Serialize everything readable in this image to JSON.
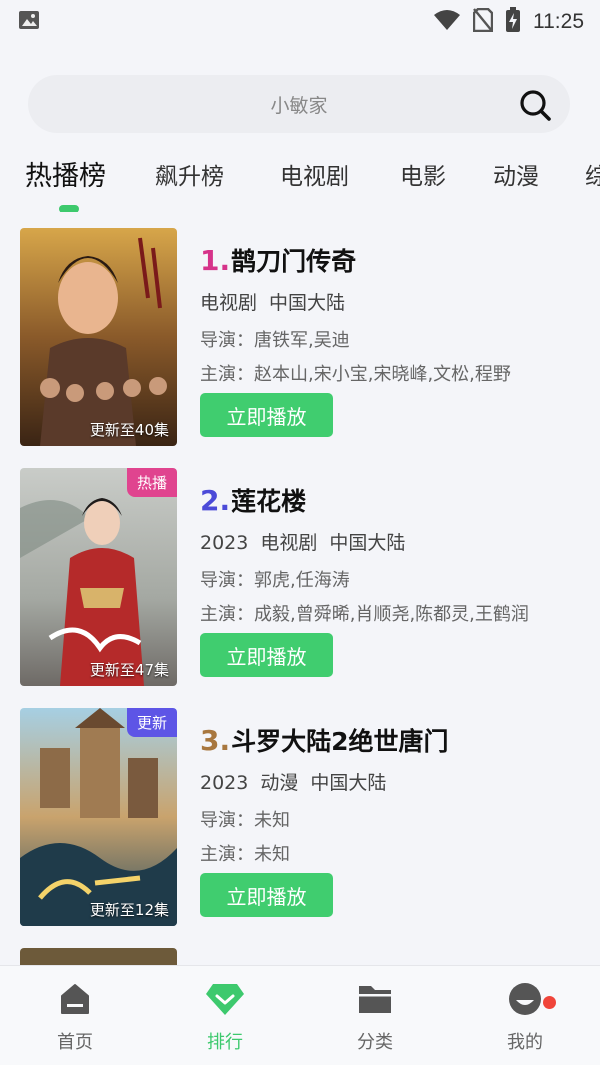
{
  "status_bar": {
    "time": "11:25"
  },
  "search": {
    "placeholder": "小敏家"
  },
  "tabs": [
    "热播榜",
    "飙升榜",
    "电视剧",
    "电影",
    "动漫",
    "综"
  ],
  "items": [
    {
      "rank": "1.",
      "rank_color": "#d6338a",
      "title": "鹊刀门传奇",
      "year": "",
      "type": "电视剧",
      "region": "中国大陆",
      "director": "导演：唐铁军,吴迪",
      "actors": "主演：赵本山,宋小宝,宋晓峰,文松,程野",
      "update": "更新至40集",
      "badge": "",
      "play_label": "立即播放"
    },
    {
      "rank": "2.",
      "rank_color": "#4b4ad8",
      "title": "莲花楼",
      "year": "2023",
      "type": "电视剧",
      "region": "中国大陆",
      "director": "导演：郭虎,任海涛",
      "actors": "主演：成毅,曾舜晞,肖顺尧,陈都灵,王鹤润",
      "update": "更新至47集",
      "badge": "热播",
      "badge_color": "#e0448f",
      "play_label": "立即播放"
    },
    {
      "rank": "3.",
      "rank_color": "#a8773f",
      "title": "斗罗大陆2绝世唐门",
      "year": "2023",
      "type": "动漫",
      "region": "中国大陆",
      "director": "导演：未知",
      "actors": "主演：未知",
      "update": "更新至12集",
      "badge": "更新",
      "badge_color": "#5d55e6",
      "play_label": "立即播放"
    }
  ],
  "bottom_nav": [
    {
      "label": "首页",
      "icon": "home-icon"
    },
    {
      "label": "排行",
      "icon": "ranking-diamond-icon"
    },
    {
      "label": "分类",
      "icon": "folder-icon"
    },
    {
      "label": "我的",
      "icon": "profile-icon"
    }
  ],
  "colors": {
    "accent": "#40cd6f",
    "notification": "#f0453a"
  }
}
